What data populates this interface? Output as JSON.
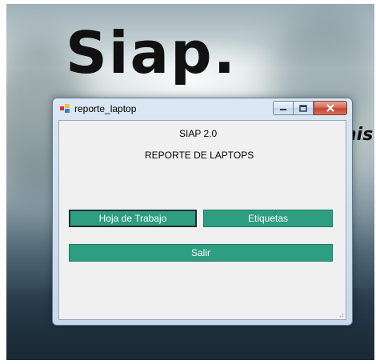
{
  "background": {
    "logo_text": "Siap.",
    "tagline_fragment": "nis"
  },
  "window": {
    "title": "reporte_laptop",
    "controls": {
      "minimize": "",
      "maximize": "",
      "close": ""
    }
  },
  "form": {
    "heading": "SIAP 2.0",
    "subheading": "REPORTE DE LAPTOPS",
    "buttons": {
      "hoja": "Hoja de Trabajo",
      "etiquetas": "Etiquetas",
      "salir": "Salir"
    }
  },
  "colors": {
    "button_bg": "#2e9e80",
    "window_frame": "#c9d9ea",
    "client_bg": "#f0f0f0"
  }
}
